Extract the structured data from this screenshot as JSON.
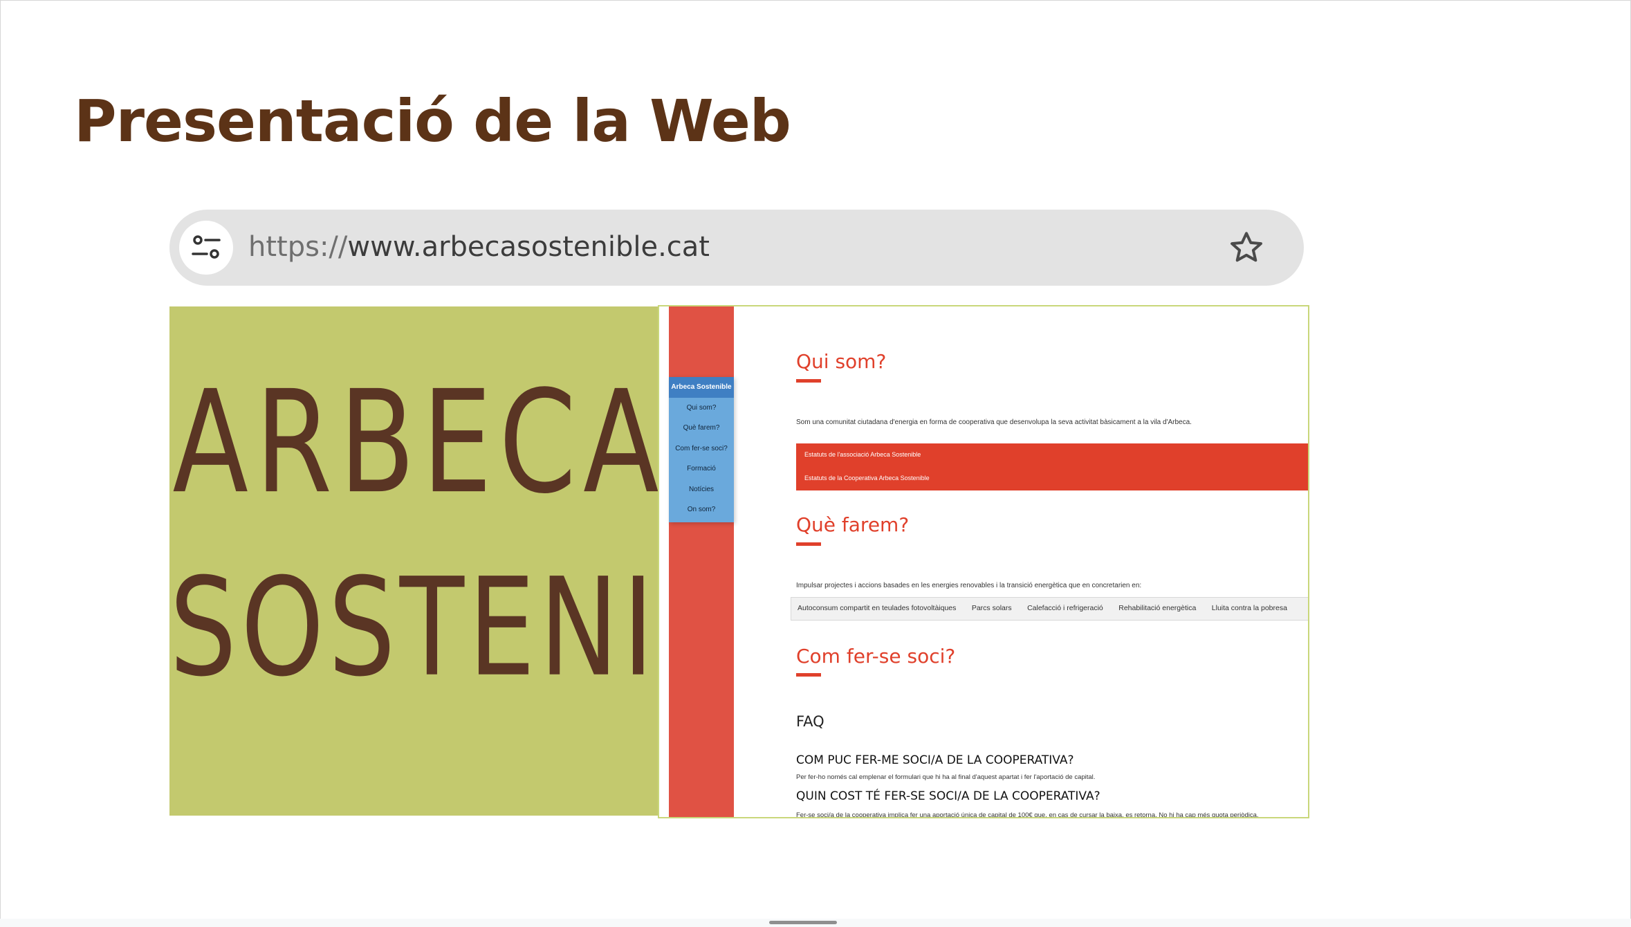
{
  "slide": {
    "title": "Presentació de la Web"
  },
  "browser": {
    "url_scheme": "https://",
    "url_host": "www.arbecasostenible.cat",
    "tune_icon": "tune-icon",
    "bookmark_icon": "star-icon"
  },
  "logo": {
    "line1": "ARBECA",
    "line2": "SOSTENIBLE"
  },
  "website": {
    "nav": [
      "Arbeca Sostenible",
      "Qui som?",
      "Què farem?",
      "Com fer-se soci?",
      "Formació",
      "Notícies",
      "On som?"
    ],
    "qui_som": {
      "title": "Qui som?",
      "text": "Som una comunitat ciutadana d'energia en forma de cooperativa que desenvolupa la seva activitat bàsicament a la vila d'Arbeca.",
      "links": [
        "Estatuts de l'associació Arbeca Sostenible",
        "Estatuts de la Cooperativa Arbeca Sostenible"
      ]
    },
    "que_farem": {
      "title": "Què farem?",
      "text": "Impulsar projectes i accions basades en les energies renovables i la transició energètica que en concretarien en:",
      "tabs": [
        "Autoconsum compartit en teulades fotovoltàiques",
        "Parcs solars",
        "Calefacció i refrigeració",
        "Rehabilitació energètica",
        "Lluita contra la pobresa"
      ]
    },
    "com_fer_se_soci": {
      "title": "Com fer-se soci?",
      "faq_label": "FAQ",
      "q1": "COM PUC FER-ME SOCI/A DE LA COOPERATIVA?",
      "a1": "Per fer-ho només cal emplenar el formulari que hi ha al final d'aquest apartat i fer l'aportació de capital.",
      "q2": "QUIN COST TÉ FER-SE SOCI/A DE LA COOPERATIVA?",
      "a2": "Fer-se soci/a de la cooperativa implica fer una aportació única de capital de 100€ que, en cas de cursar la baixa, es retorna. No hi ha cap més quota periòdica."
    }
  },
  "colors": {
    "title": "#5c3317",
    "logo_bg": "#c3c96e",
    "logo_text": "#5a3524",
    "site_red": "#e0402b",
    "nav_blue": "#6aa9dc"
  }
}
